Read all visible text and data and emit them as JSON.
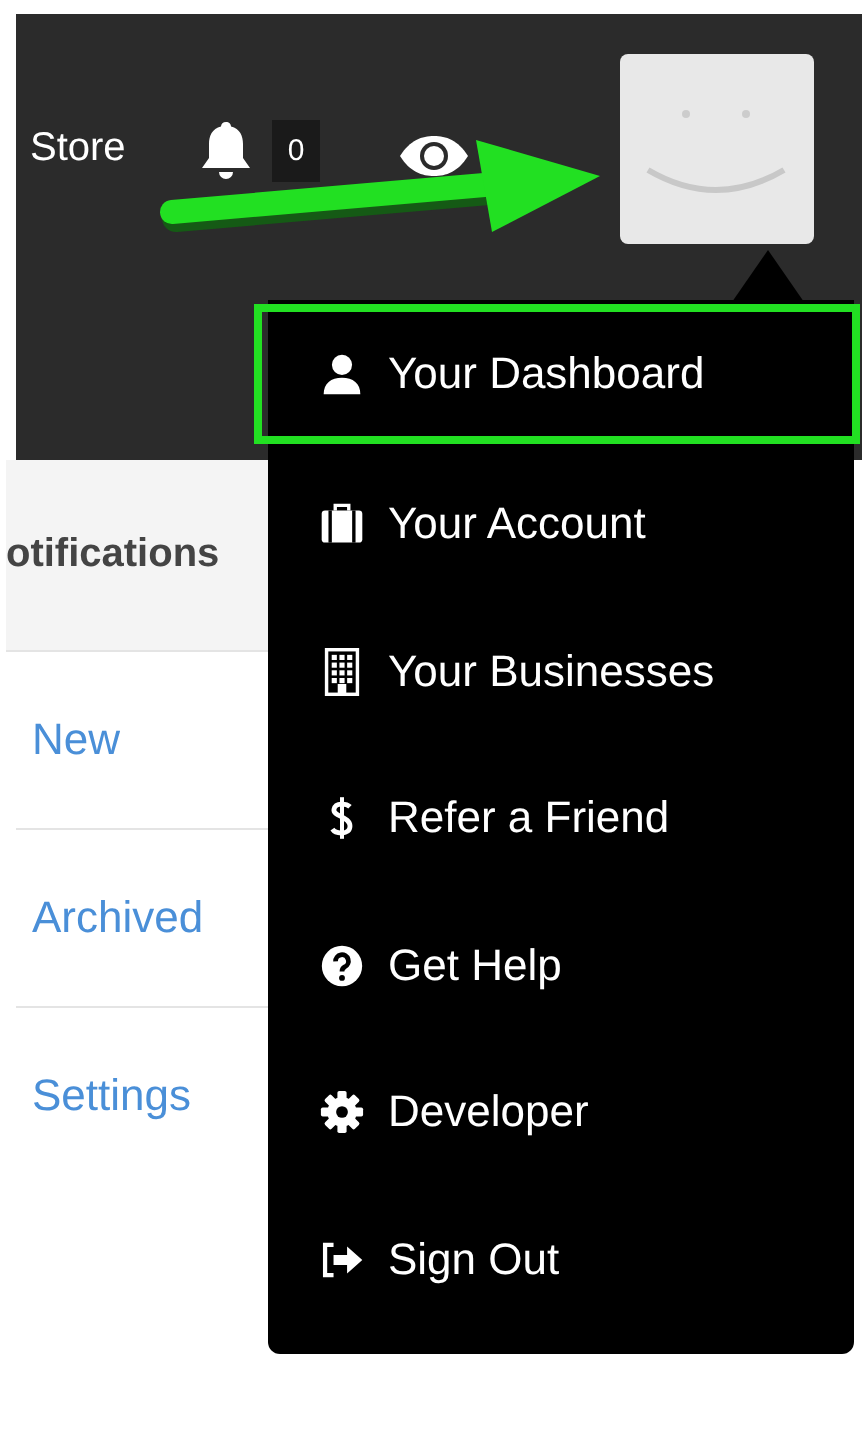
{
  "header": {
    "store_link": "Store",
    "notification_count": "0"
  },
  "notifications_panel": {
    "title": "otifications",
    "items": [
      {
        "label": "New"
      },
      {
        "label": "Archived"
      },
      {
        "label": "Settings"
      }
    ]
  },
  "user_menu": {
    "items": [
      {
        "label": "Your Dashboard",
        "selected": true
      },
      {
        "label": "Your Account",
        "selected": false
      },
      {
        "label": "Your Businesses",
        "selected": false
      },
      {
        "label": "Refer a Friend",
        "selected": false
      },
      {
        "label": "Get Help",
        "selected": false
      },
      {
        "label": "Developer",
        "selected": false
      },
      {
        "label": "Sign Out",
        "selected": false
      }
    ]
  }
}
